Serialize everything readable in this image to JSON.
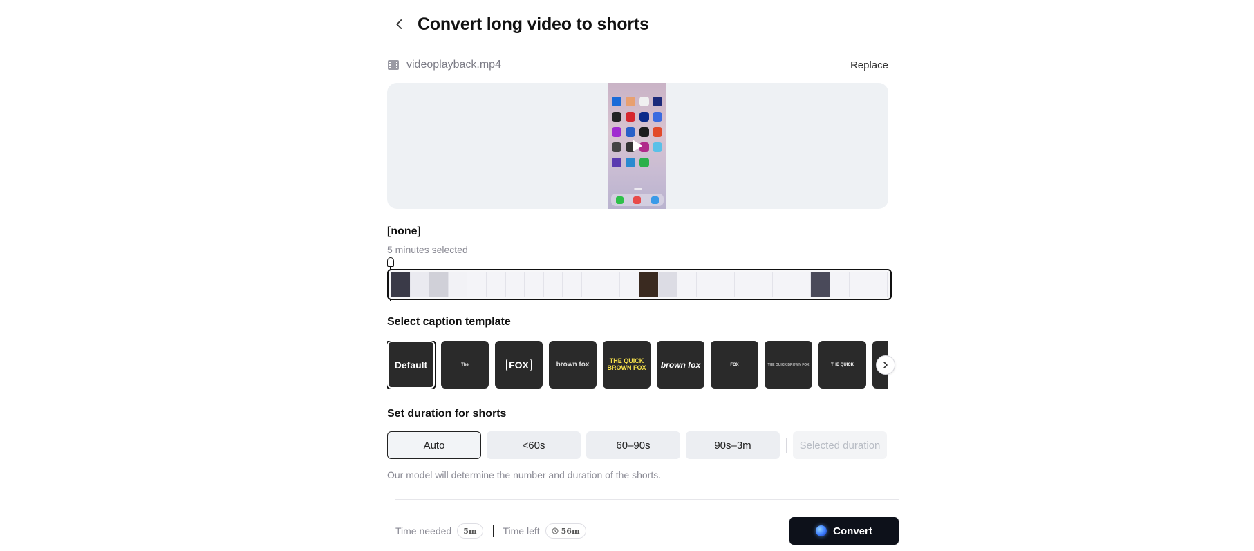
{
  "header": {
    "title": "Convert long video to shorts"
  },
  "file": {
    "name": "videoplayback.mp4",
    "replace_label": "Replace"
  },
  "segment": {
    "title": "[none]",
    "subtitle": "5 minutes selected"
  },
  "captions": {
    "title": "Select caption template",
    "templates": [
      {
        "label": "Default",
        "selected": true
      },
      {
        "label": "The"
      },
      {
        "label": "FOX"
      },
      {
        "label": "brown fox"
      },
      {
        "label": "THE QUICK BROWN FOX"
      },
      {
        "label": "brown fox"
      },
      {
        "label": "FOX"
      },
      {
        "label": "THE QUICK BROWN FOX"
      },
      {
        "label": "THE QUICK"
      },
      {
        "label": ""
      }
    ]
  },
  "duration": {
    "title": "Set duration for shorts",
    "options": [
      "Auto",
      "<60s",
      "60–90s",
      "90s–3m"
    ],
    "selected": "Auto",
    "custom_placeholder": "Selected duration",
    "help": "Our model will determine the number and duration of the shorts."
  },
  "footer": {
    "time_needed_label": "Time needed",
    "time_needed_value": "5m",
    "time_left_label": "Time left",
    "time_left_value": "56m",
    "convert_label": "Convert"
  },
  "colors": {
    "accent": "#0d111a",
    "preview_bg": "#eef1f4",
    "template_bg": "#2a2a2a"
  }
}
